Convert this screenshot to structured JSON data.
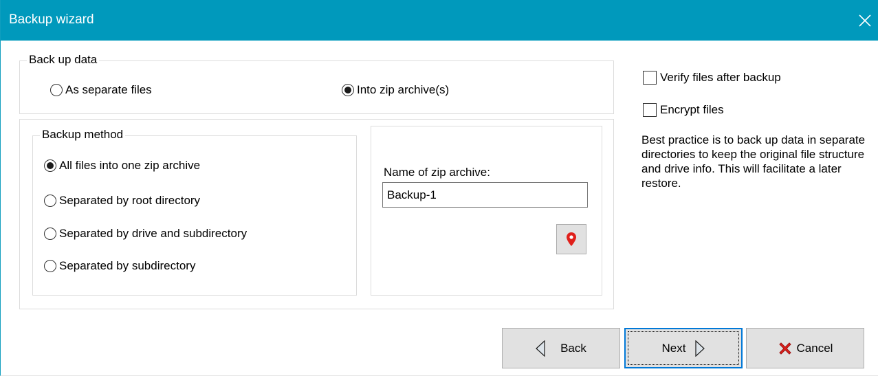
{
  "window": {
    "title": "Backup wizard",
    "close_glyph": "✕",
    "close_icon": "close-icon",
    "title_bar_color": "#0099bc"
  },
  "backup_data": {
    "legend": "Back up data",
    "options": [
      {
        "label": "As separate files",
        "selected": false
      },
      {
        "label": "Into zip archive(s)",
        "selected": true
      }
    ]
  },
  "backup_method": {
    "legend": "Backup method",
    "options": [
      {
        "label": "All files into one zip archive",
        "selected": true
      },
      {
        "label": "Separated by root directory",
        "selected": false
      },
      {
        "label": "Separated by drive and subdirectory",
        "selected": false
      },
      {
        "label": "Separated by subdirectory",
        "selected": false
      }
    ]
  },
  "zip": {
    "label": "Name of zip archive:",
    "value": "Backup-1",
    "location_button_icon": "map-pin-icon",
    "pin_color": "#e0201b"
  },
  "options": {
    "verify": {
      "label": "Verify files after backup",
      "checked": false
    },
    "encrypt": {
      "label": "Encrypt files",
      "checked": false
    }
  },
  "note": "Best practice is to back up data in separate directories to keep the original file structure and drive info. This will facilitate a later restore.",
  "footer": {
    "back_label": "Back",
    "back_icon": "triangle-left-icon",
    "next_label": "Next",
    "next_icon": "triangle-right-icon",
    "cancel_label": "Cancel",
    "cancel_icon": "red-x-icon",
    "focus_color": "#0078d7"
  }
}
